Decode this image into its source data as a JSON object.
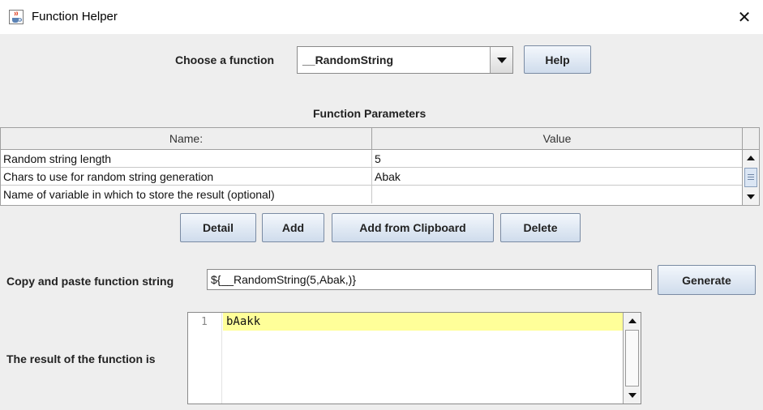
{
  "window": {
    "title": "Function Helper",
    "close": "✕"
  },
  "chooser": {
    "label": "Choose a function",
    "selected": "__RandomString",
    "help_label": "Help"
  },
  "params": {
    "heading": "Function Parameters",
    "columns": [
      "Name:",
      "Value"
    ],
    "rows": [
      {
        "name": "Random string length",
        "value": "5"
      },
      {
        "name": "Chars to use for random string generation",
        "value": "Abak"
      },
      {
        "name": "Name of variable in which to store the result (optional)",
        "value": ""
      }
    ]
  },
  "actions": {
    "detail": "Detail",
    "add": "Add",
    "add_clipboard": "Add from Clipboard",
    "delete": "Delete"
  },
  "function_string": {
    "label": "Copy and paste function string",
    "value": "${__RandomString(5,Abak,)}",
    "generate_label": "Generate"
  },
  "result": {
    "label": "The result of the function is",
    "line_number": "1",
    "text": "bAakk"
  },
  "icons": {
    "app": "java-cup-icon",
    "close": "close-icon"
  }
}
